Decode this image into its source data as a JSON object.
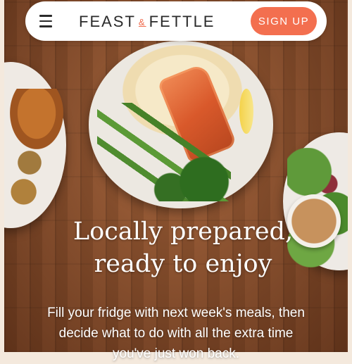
{
  "header": {
    "brand_left": "FEAST",
    "brand_amp": "&",
    "brand_right": "FETTLE",
    "signup_label": "SIGN UP",
    "menu_icon": "hamburger-menu-icon"
  },
  "hero": {
    "headline_line1": "Locally prepared,",
    "headline_line2": "ready to enjoy",
    "subtext_line1": "Fill your fridge with next week's meals, then",
    "subtext_line2": "decide what to do with all the extra time",
    "subtext_line3": "you've just won back."
  },
  "colors": {
    "accent": "#f36f4f",
    "brand_text": "#2a2a2a",
    "hero_text": "#ffffff",
    "wood": "#8c522d"
  }
}
